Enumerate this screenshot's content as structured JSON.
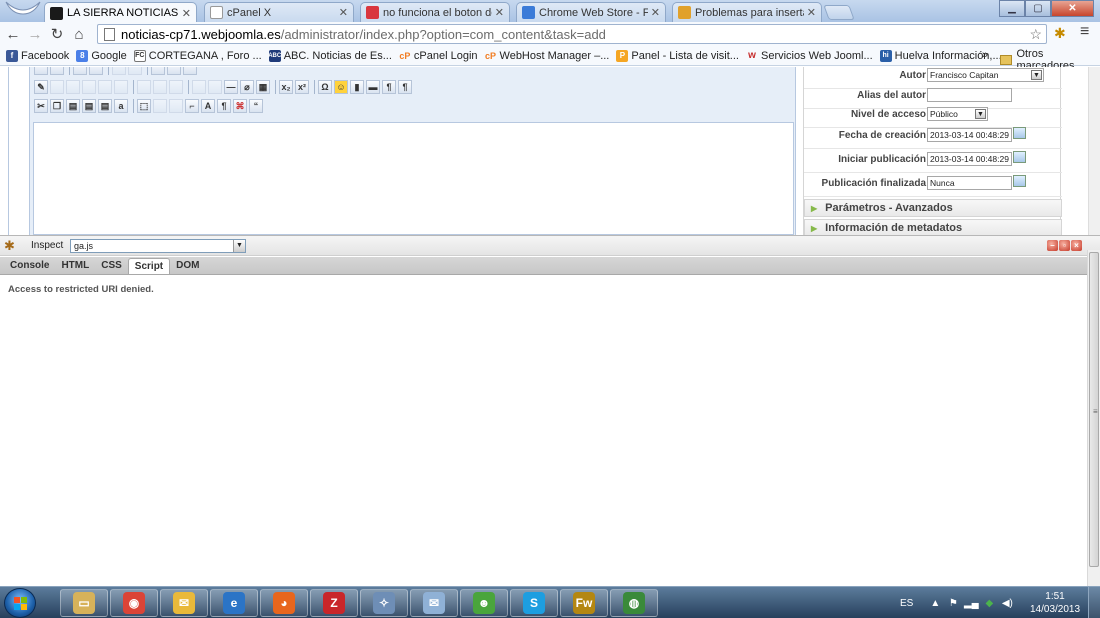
{
  "browser": {
    "tabs": [
      {
        "title": "LA SIERRA NOTICIAS - Ad",
        "active": true,
        "icon": "joomla-favicon",
        "color": "#1a1a1a"
      },
      {
        "title": "cPanel X",
        "active": false,
        "icon": "blank-page-favicon",
        "color": "#ffffff"
      },
      {
        "title": "no funciona el boton de i",
        "active": false,
        "icon": "w-favicon",
        "color": "#d9363e"
      },
      {
        "title": "Chrome Web Store - Fireb",
        "active": false,
        "icon": "webstore-favicon",
        "color": "#3b7bd8"
      },
      {
        "title": "Problemas para insertar im",
        "active": false,
        "icon": "puzzle-favicon",
        "color": "#e1a12b"
      }
    ],
    "url_host": "noticias-cp71.webjoomla.es",
    "url_path": "/administrator/index.php?option=com_content&task=add",
    "bookmarks": [
      {
        "label": "Facebook",
        "icon_color": "#3b5998",
        "glyph": "f"
      },
      {
        "label": "Google",
        "icon_color": "#4a7fe8",
        "glyph": "8"
      },
      {
        "label": "CORTEGANA , Foro ...",
        "icon_color": "#8a5a2a",
        "glyph": "FC"
      },
      {
        "label": "ABC. Noticias de Es...",
        "icon_color": "#1f3b7a",
        "glyph": "ABC"
      },
      {
        "label": "cPanel Login",
        "icon_color": "#f17c21",
        "glyph": "cP"
      },
      {
        "label": "WebHost Manager –...",
        "icon_color": "#f17c21",
        "glyph": "cP"
      },
      {
        "label": "Panel - Lista de visit...",
        "icon_color": "#f5a623",
        "glyph": "P"
      },
      {
        "label": "Servicios Web Jooml...",
        "icon_color": "#c62e2e",
        "glyph": "w"
      },
      {
        "label": "Huelva Información,...",
        "icon_color": "#2a5fa8",
        "glyph": "hi"
      }
    ],
    "bookmarks_more": "»",
    "other_bookmarks": "Otros marcadores"
  },
  "article_panel": {
    "fields": [
      {
        "label": "Autor",
        "value": "Francisco Capitan",
        "type": "select"
      },
      {
        "label": "Alias del autor",
        "value": "",
        "type": "text"
      },
      {
        "label": "Nivel de acceso",
        "value": "Público",
        "type": "select"
      },
      {
        "label": "Fecha de creación",
        "value": "2013-03-14 00:48:29",
        "type": "date"
      },
      {
        "label": "Iniciar publicación",
        "value": "2013-03-14 00:48:29",
        "type": "date"
      },
      {
        "label": "Publicación finalizada",
        "value": "Nunca",
        "type": "date"
      }
    ],
    "sections": [
      {
        "label": "Parámetros - Avanzados"
      },
      {
        "label": "Información de metadatos"
      }
    ]
  },
  "firebug": {
    "inspect_label": "Inspect",
    "script_file": "ga.js",
    "tabs": [
      {
        "label": "Console",
        "active": false
      },
      {
        "label": "HTML",
        "active": false
      },
      {
        "label": "CSS",
        "active": false
      },
      {
        "label": "Script",
        "active": true
      },
      {
        "label": "DOM",
        "active": false
      }
    ],
    "message": "Access to restricted URI denied."
  },
  "taskbar": {
    "apps": [
      {
        "name": "explorer",
        "color": "#d7b25a"
      },
      {
        "name": "chrome",
        "color": "#db4437"
      },
      {
        "name": "outlook",
        "color": "#e9b93a"
      },
      {
        "name": "internet-explorer",
        "color": "#2b74c6"
      },
      {
        "name": "firefox",
        "color": "#e8661d"
      },
      {
        "name": "filezilla",
        "color": "#c9262a"
      },
      {
        "name": "safari",
        "color": "#6e8eb6"
      },
      {
        "name": "windows-live-mail",
        "color": "#8fb1d6"
      },
      {
        "name": "messenger",
        "color": "#4aa53c"
      },
      {
        "name": "skype",
        "color": "#1d9ee0"
      },
      {
        "name": "fireworks",
        "color": "#b48712"
      },
      {
        "name": "network-globe",
        "color": "#3a8a3a"
      }
    ],
    "language": "ES",
    "time": "1:51",
    "date": "14/03/2013"
  }
}
